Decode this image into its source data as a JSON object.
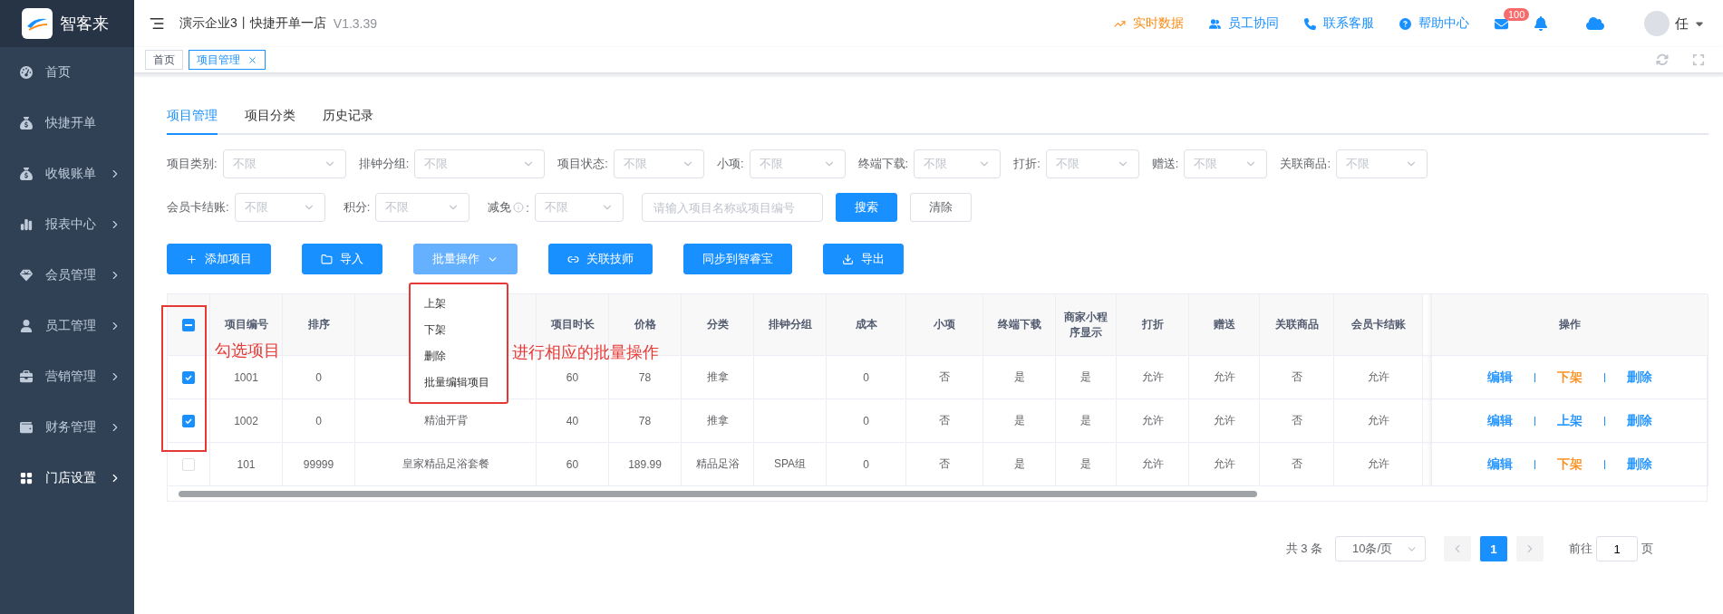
{
  "sidebar": {
    "brand": "智客来",
    "items": [
      {
        "label": "首页",
        "selected": false,
        "submenu": false
      },
      {
        "label": "快捷开单",
        "selected": false,
        "submenu": false
      },
      {
        "label": "收银账单",
        "selected": false,
        "submenu": true
      },
      {
        "label": "报表中心",
        "selected": false,
        "submenu": true
      },
      {
        "label": "会员管理",
        "selected": false,
        "submenu": true
      },
      {
        "label": "员工管理",
        "selected": false,
        "submenu": true
      },
      {
        "label": "营销管理",
        "selected": false,
        "submenu": true
      },
      {
        "label": "财务管理",
        "selected": false,
        "submenu": true
      },
      {
        "label": "门店设置",
        "selected": true,
        "submenu": true
      }
    ]
  },
  "header": {
    "title": "演示企业3丨快捷开单一店",
    "version": "V1.3.39",
    "links": [
      {
        "label": "实时数据",
        "color": "#fa8c16"
      },
      {
        "label": "员工协同",
        "color": "#1890ff"
      },
      {
        "label": "联系客服",
        "color": "#1890ff"
      },
      {
        "label": "帮助中心",
        "color": "#1890ff"
      }
    ],
    "mail_badge": "100",
    "user": "任"
  },
  "tags": [
    {
      "label": "首页",
      "selected": false
    },
    {
      "label": "项目管理",
      "selected": true
    }
  ],
  "content_tabs": [
    {
      "label": "项目管理",
      "selected": true
    },
    {
      "label": "项目分类",
      "selected": false
    },
    {
      "label": "历史记录",
      "selected": false
    }
  ],
  "filters": [
    [
      {
        "label": "项目类别:",
        "placeholder": "不限"
      },
      {
        "label": "排钟分组:",
        "placeholder": "不限"
      },
      {
        "label": "项目状态:",
        "placeholder": "不限"
      },
      {
        "label": "小项:",
        "placeholder": "不限"
      },
      {
        "label": "终端下载:",
        "placeholder": "不限"
      },
      {
        "label": "打折:",
        "placeholder": "不限"
      },
      {
        "label": "赠送:",
        "placeholder": "不限"
      },
      {
        "label": "关联商品:",
        "placeholder": "不限"
      }
    ],
    [
      {
        "label": "会员卡结账:",
        "placeholder": "不限"
      },
      {
        "label": "积分:",
        "placeholder": "不限"
      },
      {
        "label": "减免",
        "info": true,
        "colon": ":",
        "placeholder": "不限"
      }
    ]
  ],
  "search": {
    "placeholder": "请输入项目名称或项目编号"
  },
  "filter_buttons": [
    {
      "label": "搜索",
      "kind": "primary"
    },
    {
      "label": "清除",
      "kind": "plain"
    }
  ],
  "toolbar": [
    {
      "label": "添加项目"
    },
    {
      "label": "导入"
    },
    {
      "label": "批量操作",
      "open": true,
      "menu": [
        "上架",
        "下架",
        "删除",
        "批量编辑项目"
      ]
    },
    {
      "label": "关联技师"
    },
    {
      "label": "同步到智睿宝"
    },
    {
      "label": "导出"
    }
  ],
  "table": {
    "header_checkbox": {
      "indeterminate": true
    },
    "columns": [
      {
        "label": "项目编号"
      },
      {
        "label": "排序"
      },
      {},
      {
        "label": "项目时长"
      },
      {
        "label": "价格"
      },
      {
        "label": "分类"
      },
      {
        "label": "排钟分组"
      },
      {
        "label": "成本"
      },
      {
        "label": "小项"
      },
      {
        "label": "终端下载"
      },
      {
        "label": "商家小程序显示"
      },
      {
        "label": "打折"
      },
      {
        "label": "赠送"
      },
      {
        "label": "关联商品"
      },
      {
        "label": "会员卡结账"
      }
    ],
    "actions_header": "操作",
    "rows": [
      {
        "checked": true,
        "cells": [
          "1001",
          "0",
          null,
          "60",
          "78",
          "推拿",
          null,
          "0",
          "否",
          "是",
          "是",
          "允许",
          "允许",
          "否",
          "允许"
        ],
        "actions": [
          {
            "label": "编辑",
            "color": "#1890ff"
          },
          {
            "label": "下架",
            "color": "#fa8c16"
          },
          {
            "label": "删除",
            "color": "#1890ff"
          }
        ]
      },
      {
        "checked": true,
        "cells": [
          "1002",
          "0",
          "精油开背",
          "40",
          "78",
          "推拿",
          null,
          "0",
          "否",
          "是",
          "是",
          "允许",
          "允许",
          "否",
          "允许"
        ],
        "actions": [
          {
            "label": "编辑",
            "color": "#1890ff"
          },
          {
            "label": "上架",
            "color": "#1890ff"
          },
          {
            "label": "删除",
            "color": "#1890ff"
          }
        ]
      },
      {
        "checked": false,
        "cells": [
          "101",
          "99999",
          "皇家精品足浴套餐",
          "60",
          "189.99",
          "精品足浴",
          "SPA组",
          "0",
          "否",
          "是",
          "是",
          "允许",
          "允许",
          "否",
          "允许"
        ],
        "actions": [
          {
            "label": "编辑",
            "color": "#1890ff"
          },
          {
            "label": "下架",
            "color": "#fa8c16"
          },
          {
            "label": "删除",
            "color": "#1890ff"
          }
        ]
      }
    ],
    "annotations": [
      {
        "text": "勾选项目"
      },
      {
        "text": "进行相应的批量操作"
      }
    ]
  },
  "pagination": {
    "total": "共 3 条",
    "page_size": "10条/页",
    "pages": [
      {
        "label": "1",
        "selected": true
      }
    ],
    "goto_label": "前往",
    "goto_value": "1",
    "goto_suffix": "页"
  }
}
